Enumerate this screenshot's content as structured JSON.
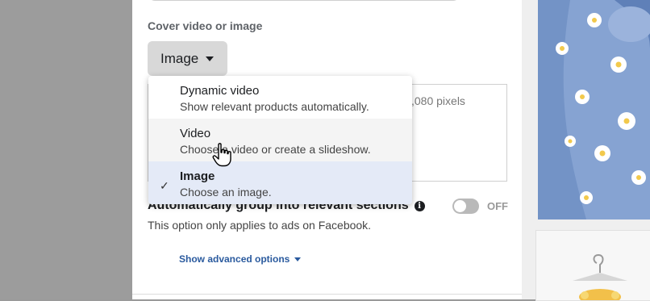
{
  "section": {
    "label": "Cover video or image",
    "dropdown_value": "Image",
    "image_hint": ",080 pixels"
  },
  "menu": {
    "items": [
      {
        "title": "Dynamic video",
        "description": "Show relevant products automatically.",
        "selected": false
      },
      {
        "title": "Video",
        "description": "Choose a video or create a slideshow.",
        "selected": false
      },
      {
        "title": "Image",
        "description": "Choose an image.",
        "selected": true
      }
    ]
  },
  "auto_group": {
    "label": "Automatically group into relevant sections",
    "toggle_state": "OFF",
    "note": "This option only applies to ads on Facebook."
  },
  "advanced_link": "Show advanced options",
  "colors": {
    "link": "#2a5a9e",
    "selected_bg": "#e4eaf7",
    "hover_bg": "#f4f4f4",
    "dropdown_bg": "#d8d8d8"
  },
  "icons": [
    "caret-down-icon",
    "checkmark-icon",
    "info-icon",
    "hand-pointer-cursor"
  ]
}
